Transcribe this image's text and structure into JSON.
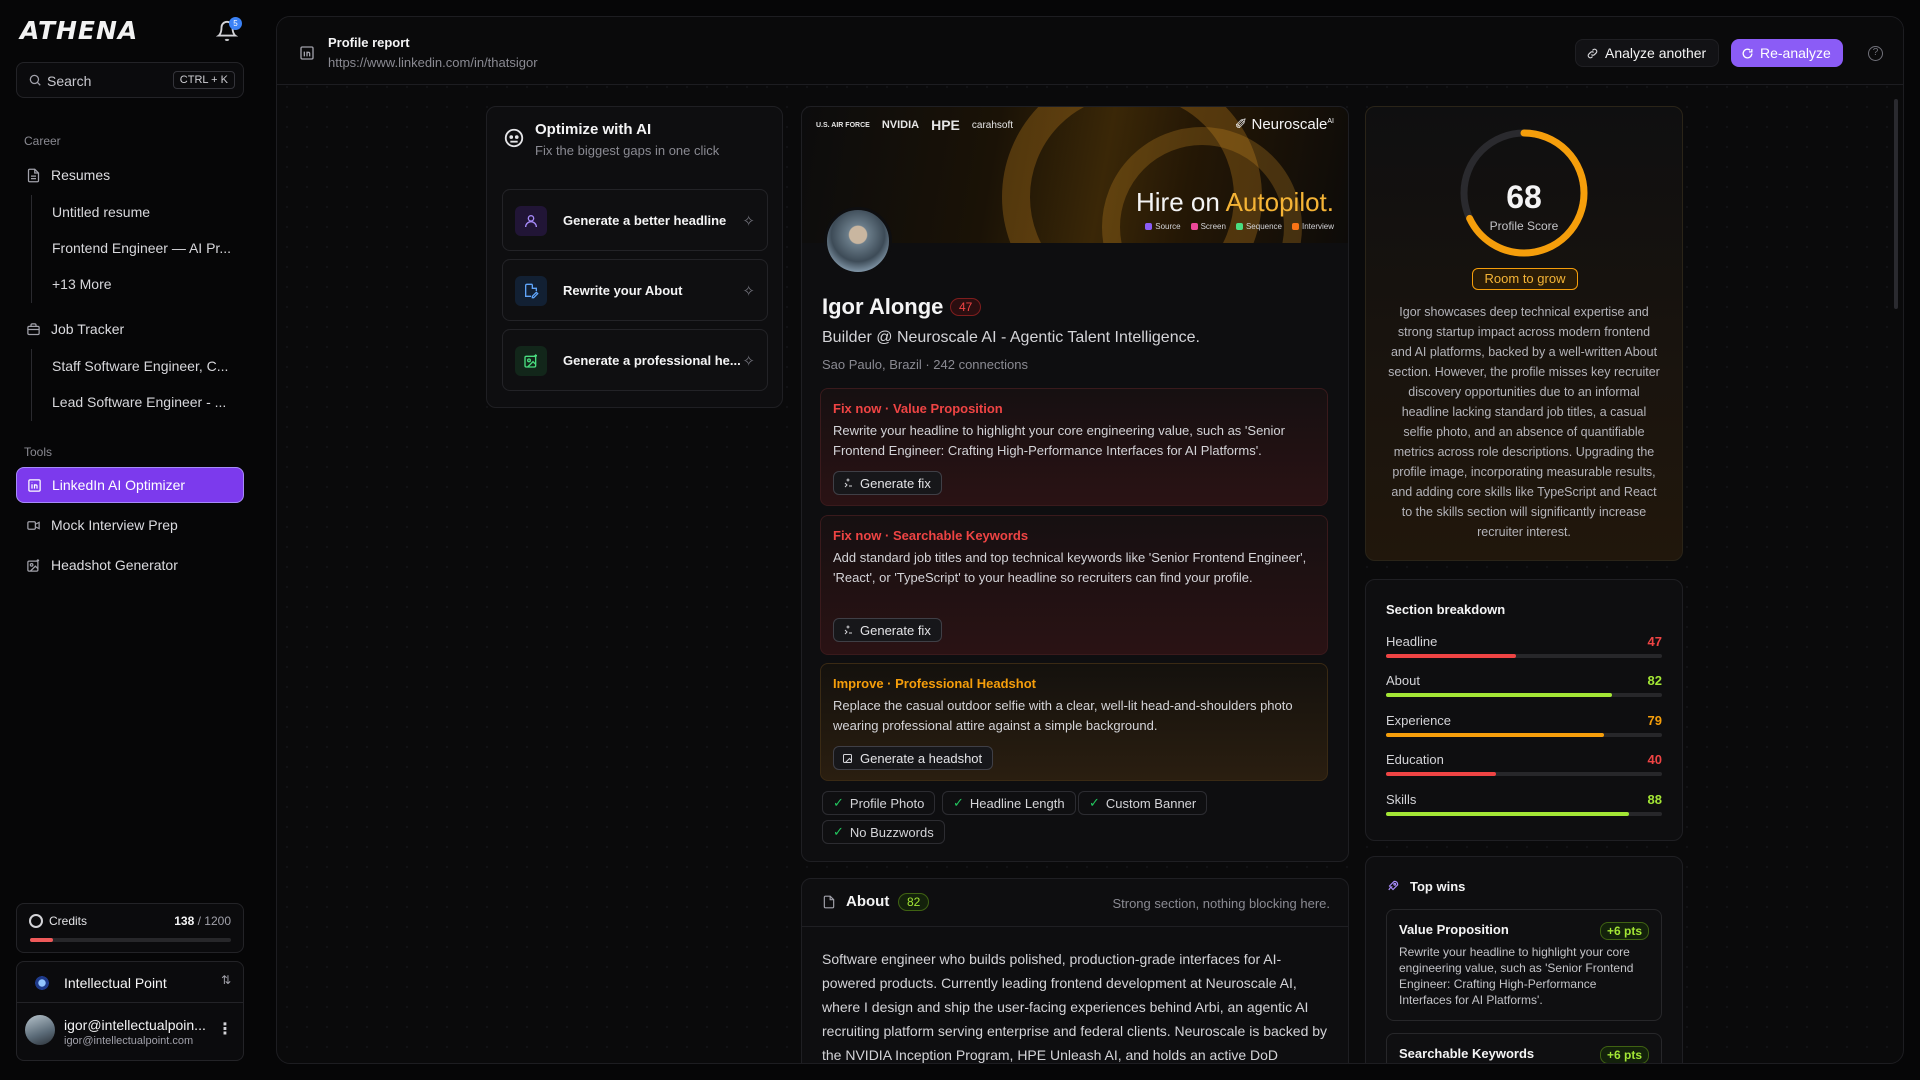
{
  "app": {
    "name": "ATHENA",
    "notification_count": "5"
  },
  "search": {
    "placeholder": "Search",
    "shortcut": "CTRL + K"
  },
  "sidebar": {
    "career_label": "Career",
    "resumes_label": "Resumes",
    "resume_items": [
      "Untitled resume",
      "Frontend Engineer — AI Pr...",
      "+13 More"
    ],
    "job_tracker_label": "Job Tracker",
    "job_items": [
      "Staff Software Engineer, C...",
      "Lead Software Engineer - ..."
    ],
    "tools_label": "Tools",
    "tools": [
      "LinkedIn AI Optimizer",
      "Mock Interview Prep",
      "Headshot Generator"
    ]
  },
  "credits": {
    "label": "Credits",
    "used": "138",
    "total": "/ 1200",
    "fraction": 0.115
  },
  "org": {
    "name": "Intellectual Point"
  },
  "user": {
    "email": "igor@intellectualpoin...",
    "email_full": "igor@intellectualpoint.com"
  },
  "topbar": {
    "title": "Profile report",
    "url": "https://www.linkedin.com/in/thatsigor",
    "analyze_label": "Analyze another",
    "reanalyze_label": "Re-analyze",
    "help": "?"
  },
  "optimize": {
    "title": "Optimize with AI",
    "subtitle": "Fix the biggest gaps in one click",
    "actions": [
      "Generate a better headline",
      "Rewrite your About",
      "Generate a professional he..."
    ]
  },
  "banner": {
    "logos": [
      "U.S. AIR FORCE",
      "NVIDIA",
      "HPE",
      "carahsoft"
    ],
    "brand": "Neuroscale",
    "brand_sup": "AI",
    "hire_prefix": "Hire on ",
    "hire_accent": "Autopilot.",
    "legend": [
      "Source",
      "Screen",
      "Sequence",
      "Interview"
    ]
  },
  "profile": {
    "name": "Igor Alonge",
    "score": "47",
    "headline": "Builder @ Neuroscale AI - Agentic Talent Intelligence.",
    "location": "Sao Paulo, Brazil · 242 connections"
  },
  "fixes": [
    {
      "title": "Fix now · Value Proposition",
      "desc": "Rewrite your headline to highlight your core engineering value, such as 'Senior Frontend Engineer: Crafting High-Performance Interfaces for AI Platforms'.",
      "button": "Generate fix"
    },
    {
      "title": "Fix now · Searchable Keywords",
      "desc": "Add standard job titles and top technical keywords like 'Senior Frontend Engineer', 'React', or 'TypeScript' to your headline so recruiters can find your profile.",
      "button": "Generate fix"
    },
    {
      "title": "Improve · Professional Headshot",
      "desc": "Replace the casual outdoor selfie with a clear, well-lit head-and-shoulders photo wearing professional attire against a simple background.",
      "button": "Generate a headshot"
    }
  ],
  "checks": [
    "Profile Photo",
    "Headline Length",
    "Custom Banner",
    "No Buzzwords"
  ],
  "check_mark": "✓",
  "about": {
    "title": "About",
    "score": "82",
    "status": "Strong section, nothing blocking here.",
    "body": "Software engineer who builds polished, production-grade interfaces for AI-powered products. Currently leading frontend development at Neuroscale AI, where I design and ship the user-facing experiences behind Arbi, an agentic AI recruiting platform serving enterprise and federal clients. Neuroscale is backed by the NVIDIA Inception Program, HPE Unleash AI, and holds an active DoD"
  },
  "score": {
    "value": "68",
    "fraction": 0.68,
    "label": "Profile Score",
    "badge": "Room to grow",
    "summary": "Igor showcases deep technical expertise and strong startup impact across modern frontend and AI platforms, backed by a well-written About section. However, the profile misses key recruiter discovery opportunities due to an informal headline lacking standard job titles, a casual selfie photo, and an absence of quantifiable metrics across role descriptions. Upgrading the profile image, incorporating measurable results, and adding core skills like TypeScript and React to the skills section will significantly increase recruiter interest."
  },
  "breakdown": {
    "title": "Section breakdown",
    "rows": [
      {
        "name": "Headline",
        "value": "47",
        "pct": 47,
        "color": "#ef4444"
      },
      {
        "name": "About",
        "value": "82",
        "pct": 82,
        "color": "#a3e635"
      },
      {
        "name": "Experience",
        "value": "79",
        "pct": 79,
        "color": "#f59e0b"
      },
      {
        "name": "Education",
        "value": "40",
        "pct": 40,
        "color": "#ef4444"
      },
      {
        "name": "Skills",
        "value": "88",
        "pct": 88,
        "color": "#a3e635"
      }
    ]
  },
  "top_wins": {
    "title": "Top wins",
    "items": [
      {
        "title": "Value Proposition",
        "pts": "+6 pts",
        "desc": "Rewrite your headline to highlight your core engineering value, such as 'Senior Frontend Engineer: Crafting High-Performance Interfaces for AI Platforms'."
      },
      {
        "title": "Searchable Keywords",
        "pts": "+6 pts",
        "desc": ""
      }
    ]
  }
}
